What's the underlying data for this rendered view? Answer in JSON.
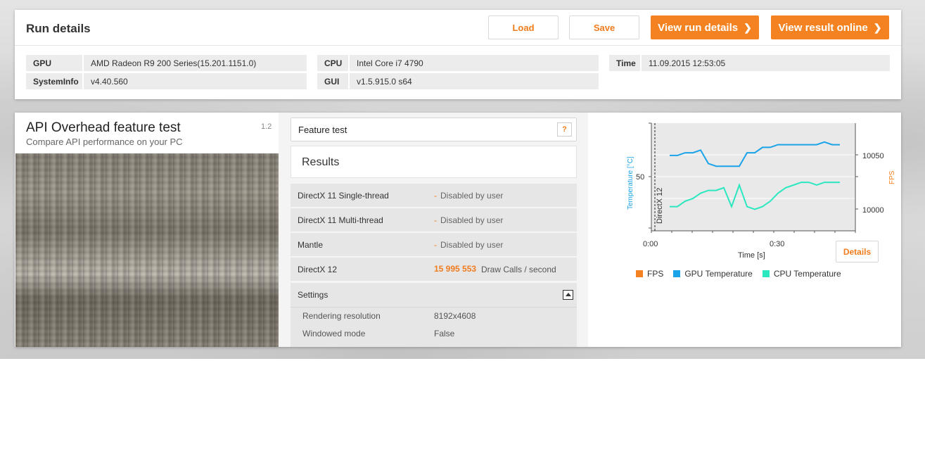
{
  "run_details": {
    "title": "Run details",
    "load_label": "Load",
    "save_label": "Save",
    "view_run_label": "View run details",
    "view_online_label": "View result online",
    "chevron": "❯",
    "gpu_key": "GPU",
    "gpu_value": "AMD Radeon R9 200 Series(15.201.1151.0)",
    "sysinfo_key": "SystemInfo",
    "sysinfo_value": "v4.40.560",
    "cpu_key": "CPU",
    "cpu_value": "Intel Core i7 4790",
    "gui_key": "GUI",
    "gui_value": "v1.5.915.0 s64",
    "time_key": "Time",
    "time_value": "11.09.2015 12:53:05"
  },
  "test": {
    "title": "API Overhead feature test",
    "subtitle": "Compare API performance on your PC",
    "version": "1.2",
    "feature_label": "Feature test",
    "help_label": "?",
    "results_label": "Results",
    "rows": [
      {
        "name": "DirectX 11 Single-thread",
        "dash": "-",
        "status": "Disabled by user"
      },
      {
        "name": "DirectX 11 Multi-thread",
        "dash": "-",
        "status": "Disabled by user"
      },
      {
        "name": "Mantle",
        "dash": "-",
        "status": "Disabled by user"
      }
    ],
    "dx12": {
      "name": "DirectX 12",
      "score": "15 995 553",
      "unit": "Draw Calls / second"
    },
    "settings_label": "Settings",
    "settings": [
      {
        "name": "Rendering resolution",
        "value": "8192x4608"
      },
      {
        "name": "Windowed mode",
        "value": "False"
      }
    ]
  },
  "chart": {
    "details_label": "Details",
    "legend": [
      {
        "label": "FPS",
        "color": "#f58220"
      },
      {
        "label": "GPU Temperature",
        "color": "#1aa3e8"
      },
      {
        "label": "CPU Temperature",
        "color": "#2be8c0"
      }
    ]
  },
  "chart_data": {
    "type": "line",
    "xlabel": "Time [s]",
    "ylabel_left": "Temperature [°C]",
    "ylabel_right": "FPS",
    "x_ticks": [
      "0:00",
      "0:30"
    ],
    "y_left_ticks": [
      "50"
    ],
    "y_right_ticks": [
      "10050",
      "10000"
    ],
    "annotation": "DirectX 12",
    "x": [
      2,
      4,
      6,
      8,
      10,
      12,
      14,
      16,
      18,
      20,
      22,
      24,
      26,
      28,
      30,
      32,
      34,
      36,
      38,
      40,
      42,
      44,
      46,
      48,
      50
    ],
    "series": [
      {
        "name": "GPU Temperature",
        "color": "#1aa3e8",
        "values": [
          58,
          58,
          59,
          59,
          60,
          55,
          54,
          54,
          54,
          54,
          59,
          59,
          61,
          61,
          62,
          62,
          62,
          62,
          62,
          62,
          63,
          62,
          62
        ]
      },
      {
        "name": "CPU Temperature",
        "color": "#2be8c0",
        "values": [
          39,
          39,
          41,
          42,
          44,
          45,
          45,
          46,
          39,
          47,
          39,
          38,
          39,
          41,
          44,
          46,
          47,
          48,
          48,
          47,
          48,
          48,
          48
        ]
      }
    ],
    "y_left_range": [
      30,
      70
    ],
    "x_range": [
      0,
      50
    ]
  }
}
